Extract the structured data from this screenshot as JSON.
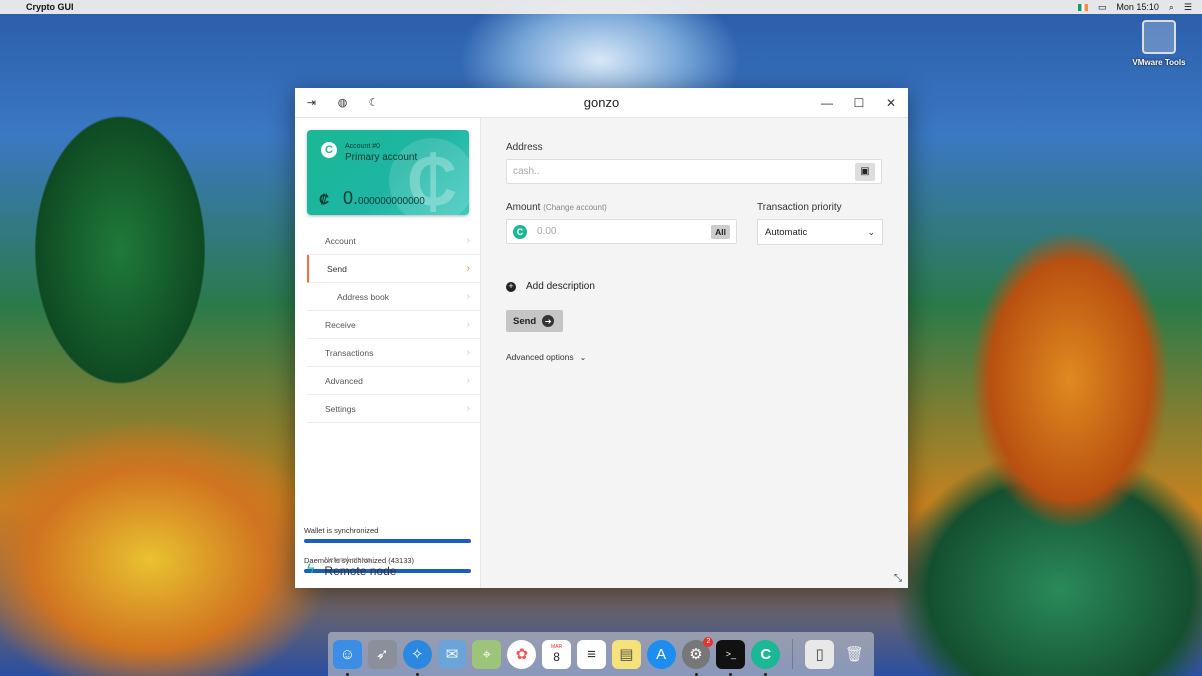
{
  "menubar": {
    "app_name": "Crypto GUI",
    "clock": "Mon 15:10"
  },
  "desktop": {
    "icon_label": "VMware Tools"
  },
  "window": {
    "title": "gonzo"
  },
  "account_card": {
    "account_number": "Account #0",
    "account_name": "Primary account",
    "currency_symbol": "₡",
    "balance_int": "0.",
    "balance_dec": "000000000000"
  },
  "sidebar": {
    "items": [
      {
        "label": "Account"
      },
      {
        "label": "Send"
      },
      {
        "label": "Address book"
      },
      {
        "label": "Receive"
      },
      {
        "label": "Transactions"
      },
      {
        "label": "Advanced"
      },
      {
        "label": "Settings"
      }
    ],
    "wallet_sync": "Wallet is synchronized",
    "wallet_progress": 1.0,
    "daemon_sync": "Daemon is synchronized (43133)",
    "daemon_progress": 1.0,
    "network_label": "Network status",
    "network_value": "Remote node"
  },
  "form": {
    "address_label": "Address",
    "address_placeholder": "cash..",
    "amount_label": "Amount",
    "amount_hint": "(Change account)",
    "amount_placeholder": "0.00",
    "all_label": "All",
    "priority_label": "Transaction priority",
    "priority_value": "Automatic",
    "add_description": "Add description",
    "send_label": "Send",
    "advanced_options": "Advanced options"
  },
  "dock": {
    "terminal_glyph": ">_",
    "calendar_month": "MAR",
    "calendar_day": "8",
    "settings_badge": "2"
  },
  "colors": {
    "accent": "#ff6c3c",
    "brand": "#1ab894",
    "progress": "#1a5ec2"
  }
}
